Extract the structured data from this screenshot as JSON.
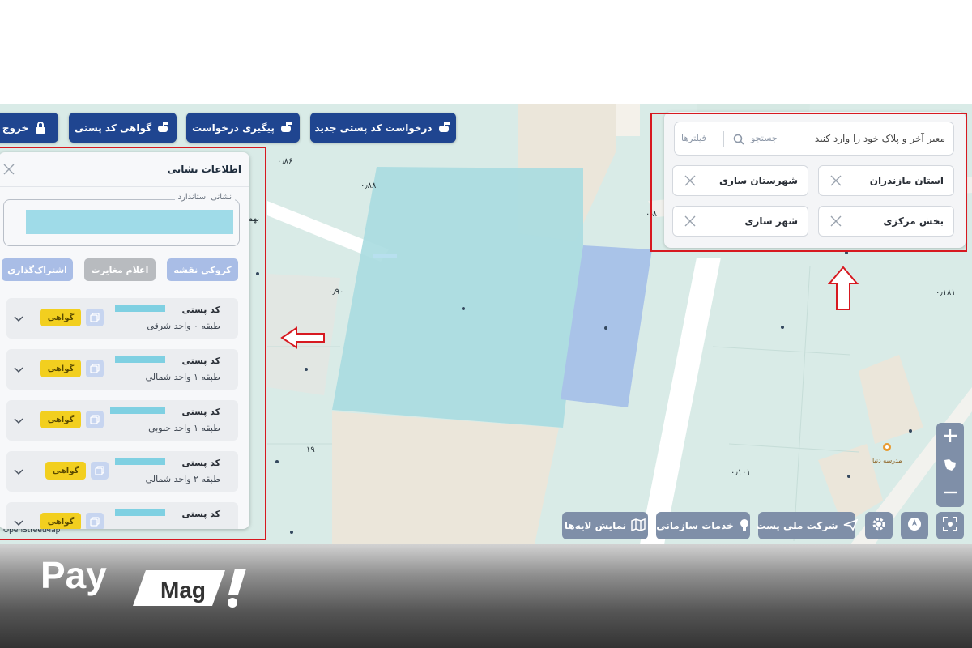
{
  "toolbar": {
    "new_postcode_request": "درخواست کد پستی جدید",
    "track_request": "پیگیری درخواست",
    "postcode_certificate": "گواهی کد پستی",
    "logout": "خروج"
  },
  "search": {
    "placeholder": "معبر آخر و پلاک خود را وارد کنید",
    "search_label": "جستجو",
    "filters_label": "فیلترها"
  },
  "filters": {
    "province": "استان مازندران",
    "county": "شهرستان ساری",
    "district": "بخش مرکزی",
    "city": "شهر ساری"
  },
  "info_panel": {
    "title": "اطلاعات نشانی",
    "address_legend": "نشانی استاندارد",
    "actions": {
      "map_sketch": "کروکی نقشه",
      "report_mismatch": "اعلام مغایرت",
      "share": "اشتراک‌گذاری"
    },
    "postcodes": [
      {
        "label": "کد پستی",
        "detail": "طبقه ۰  واحد شرقی",
        "certificate": "گواهی"
      },
      {
        "label": "کد پستی",
        "detail": "طبقه ۱  واحد شمالی",
        "certificate": "گواهی"
      },
      {
        "label": "کد پستی",
        "detail": "طبقه ۱  واحد جنوبی",
        "certificate": "گواهی"
      },
      {
        "label": "کد پستی",
        "detail": "طبقه ۲  واحد شمالی",
        "certificate": "گواهی"
      },
      {
        "label": "کد پستی",
        "detail": "",
        "certificate": "گواهی"
      }
    ]
  },
  "map_controls": {
    "show_layers": "نمایش لایه‌ها",
    "org_services": "خدمات سازمانی",
    "national_post": "شرکت ملی پست"
  },
  "map_labels": {
    "l1": "۰٫۸۶",
    "l2": "۰٫۸۸",
    "l3": "۰٫۹۰",
    "l4": "۱۹",
    "l5": "۰٫۱۰۱",
    "l6": "۰٫۱۸۱",
    "l7": "۰٫۸",
    "l8": "مدرسه دنیا",
    "l9": "OpenStreetMap",
    "l10": "بهم"
  },
  "brand": {
    "pay": "Pay",
    "mag": "Mag",
    "accent": "#1f4590",
    "annotation": "#d71920"
  }
}
